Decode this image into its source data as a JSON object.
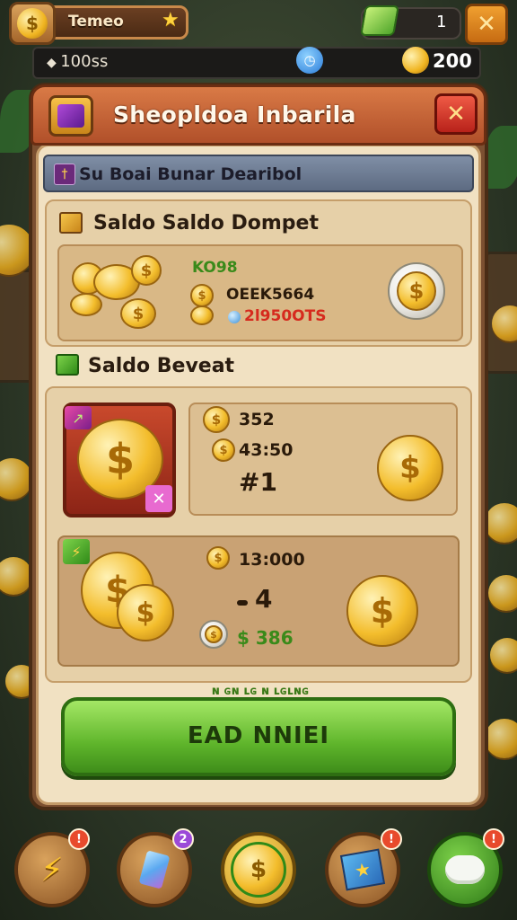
{
  "topbar": {
    "player_name": "Temeo",
    "gem_count": "1",
    "resource_left": "100ss",
    "gold_count": "200"
  },
  "panel": {
    "title": "Sheopldoa Inbarila",
    "subtitle": "Su Boai Bunar Dearibol",
    "wallet": {
      "title": "Saldo Saldo Dompet",
      "line1": "KO98",
      "line2": "OEEK5664",
      "line3": "2l950OTS"
    },
    "balance_label": "Saldo Beveat",
    "offer1": {
      "line1": "352",
      "line2": "43:50",
      "price": "#1"
    },
    "offer2": {
      "line1": "13:000",
      "line2": "4",
      "price": "$ 386"
    },
    "fine_print": "ɴ  ɢɴ ʟɢ ɴ ʟɢʟɴɢ",
    "cta_label": "EAD NNIEI"
  },
  "nav": {
    "items": [
      {
        "icon": "lightning-icon",
        "badge": ""
      },
      {
        "icon": "crystal-icon",
        "badge": "2"
      },
      {
        "icon": "gold-medal-icon",
        "badge": ""
      },
      {
        "icon": "star-map-icon",
        "badge": ""
      },
      {
        "icon": "cloud-icon",
        "badge": ""
      }
    ]
  },
  "colors": {
    "panel_brown": "#7c5031",
    "parchment": "#f1e1c2",
    "header_orange": "#c8602f",
    "cta_green": "#5fb52b",
    "gold": "#f3bd2c"
  }
}
